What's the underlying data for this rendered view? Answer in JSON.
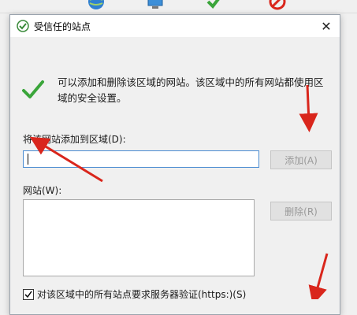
{
  "dialog": {
    "title": "受信任的站点",
    "close_glyph": "✕",
    "info_text": "可以添加和删除该区域的网站。该区域中的所有网站都使用区域的安全设置。",
    "add_label": "将该网站添加到区域(D):",
    "add_input_value": "",
    "add_button": "添加(A)",
    "sites_label": "网站(W):",
    "remove_button": "删除(R)",
    "https_checkbox_label": "对该区域中的所有站点要求服务器验证(https:)(S)",
    "https_checkbox_checked": true
  },
  "colors": {
    "accent_input_border": "#4a8bd1",
    "annotation_arrow": "#d9261c",
    "check_green": "#3aa53a"
  },
  "icons": [
    "globe-icon",
    "computer-icon",
    "check-icon",
    "blocked-icon",
    "trusted-sites-icon",
    "close-icon",
    "green-check-icon"
  ]
}
